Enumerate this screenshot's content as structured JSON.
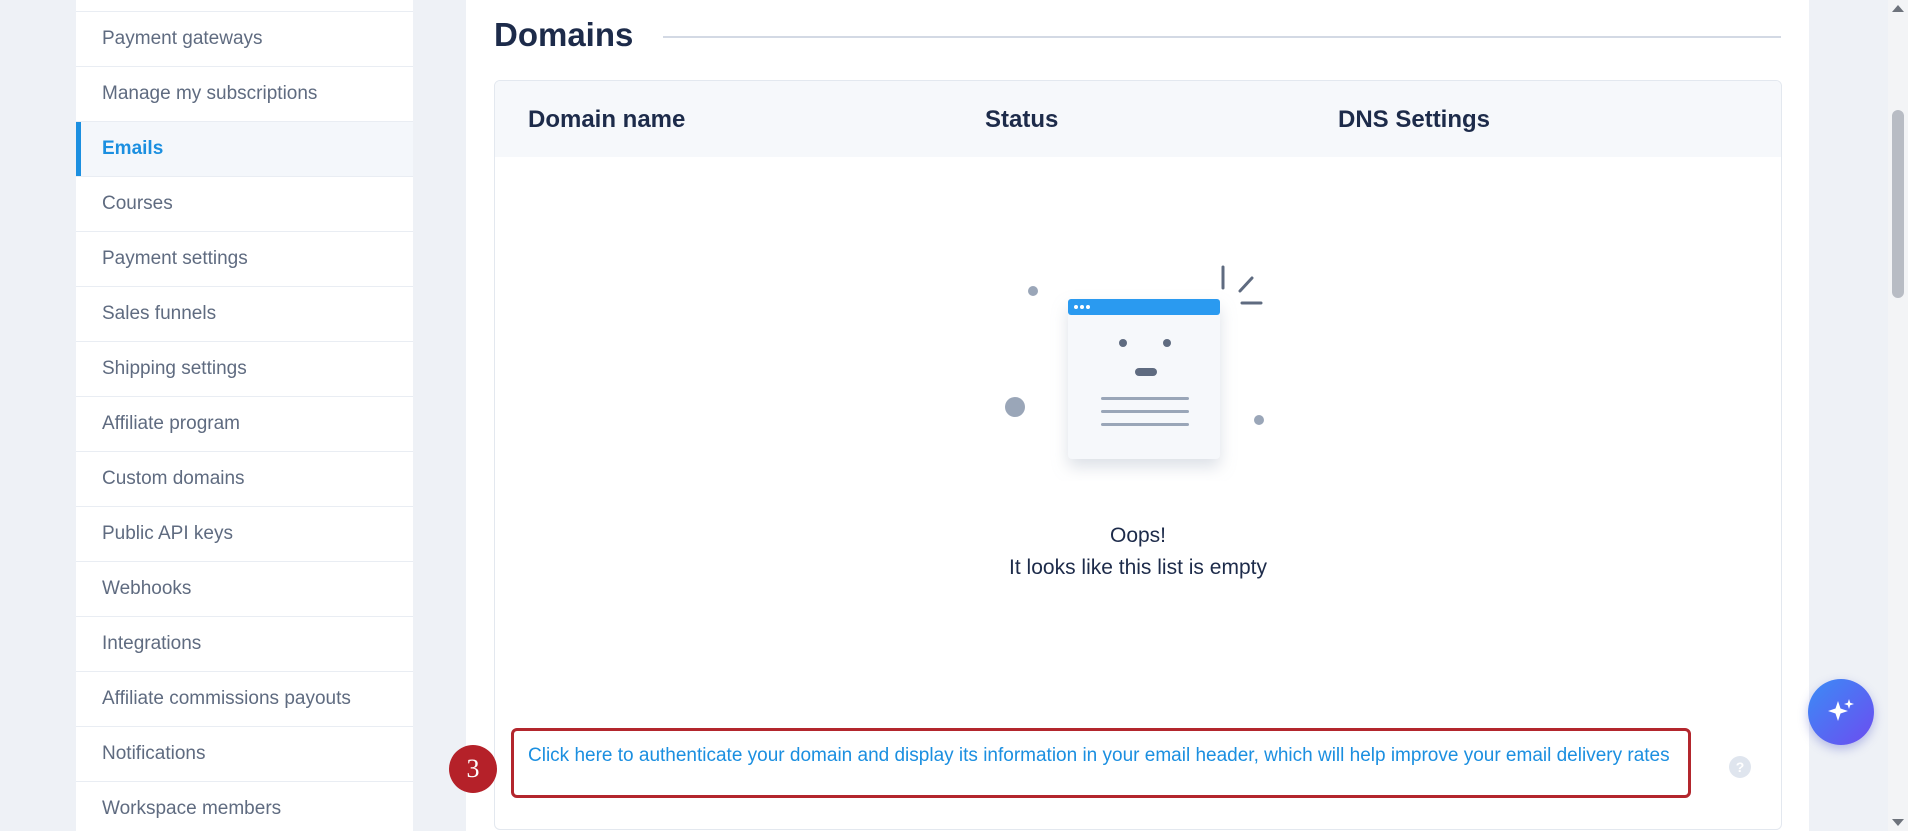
{
  "sidebar": {
    "items": [
      {
        "label": "Payment gateways",
        "active": false
      },
      {
        "label": "Manage my subscriptions",
        "active": false
      },
      {
        "label": "Emails",
        "active": true
      },
      {
        "label": "Courses",
        "active": false
      },
      {
        "label": "Payment settings",
        "active": false
      },
      {
        "label": "Sales funnels",
        "active": false
      },
      {
        "label": "Shipping settings",
        "active": false
      },
      {
        "label": "Affiliate program",
        "active": false
      },
      {
        "label": "Custom domains",
        "active": false
      },
      {
        "label": "Public API keys",
        "active": false
      },
      {
        "label": "Webhooks",
        "active": false
      },
      {
        "label": "Integrations",
        "active": false
      },
      {
        "label": "Affiliate commissions payouts",
        "active": false
      },
      {
        "label": "Notifications",
        "active": false
      },
      {
        "label": "Workspace members",
        "active": false
      }
    ]
  },
  "main": {
    "title": "Domains",
    "table": {
      "columns": [
        "Domain name",
        "Status",
        "DNS Settings"
      ],
      "empty_title": "Oops!",
      "empty_message": "It looks like this list is empty"
    },
    "auth_link": "Click here to authenticate your domain and display its information in your email header, which will help improve your email delivery rates",
    "help_icon_glyph": "?",
    "step_badge": "3"
  },
  "colors": {
    "accent": "#1b8fe0",
    "highlight_border": "#b3262d",
    "badge": "#b52129"
  },
  "icons": {
    "ai_button": "sparkle-icon",
    "help": "question-icon"
  }
}
